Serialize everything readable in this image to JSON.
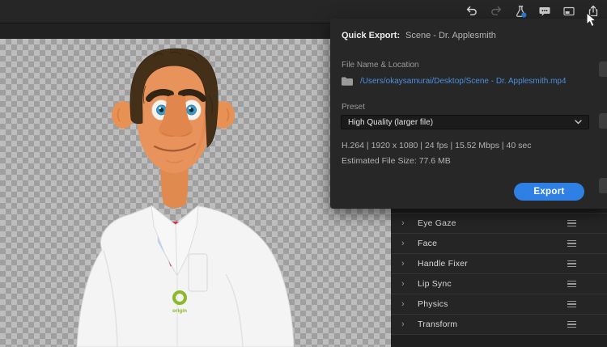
{
  "toolbar": {
    "icons": [
      "undo",
      "redo",
      "toggle-experimental",
      "show-comments",
      "picture-in-picture",
      "quick-export"
    ]
  },
  "quick_export": {
    "title": "Quick Export:",
    "scene_name": "Scene - Dr. Applesmith",
    "file_label": "File Name & Location",
    "file_path": "/Users/okaysamurai/Desktop/Scene - Dr. Applesmith.mp4",
    "preset_label": "Preset",
    "preset_value": "High Quality (larger file)",
    "format_info": "H.264 | 1920 x 1080 | 24 fps | 15.52 Mbps | 40 sec",
    "estimated_size": "Estimated File Size: 77.6 MB",
    "export_button_label": "Export"
  },
  "behaviors_panel": {
    "items": [
      {
        "label": "Eye Gaze"
      },
      {
        "label": "Face"
      },
      {
        "label": "Handle Fixer"
      },
      {
        "label": "Lip Sync"
      },
      {
        "label": "Physics"
      },
      {
        "label": "Transform"
      }
    ]
  },
  "scene": {
    "character_badge_text": "origin"
  },
  "colors": {
    "accent_blue": "#2e80e4",
    "link_blue": "#4a8fe0",
    "panel_bg": "#272727",
    "checker_light": "#bdbdbd",
    "checker_dark": "#9f9f9f"
  }
}
